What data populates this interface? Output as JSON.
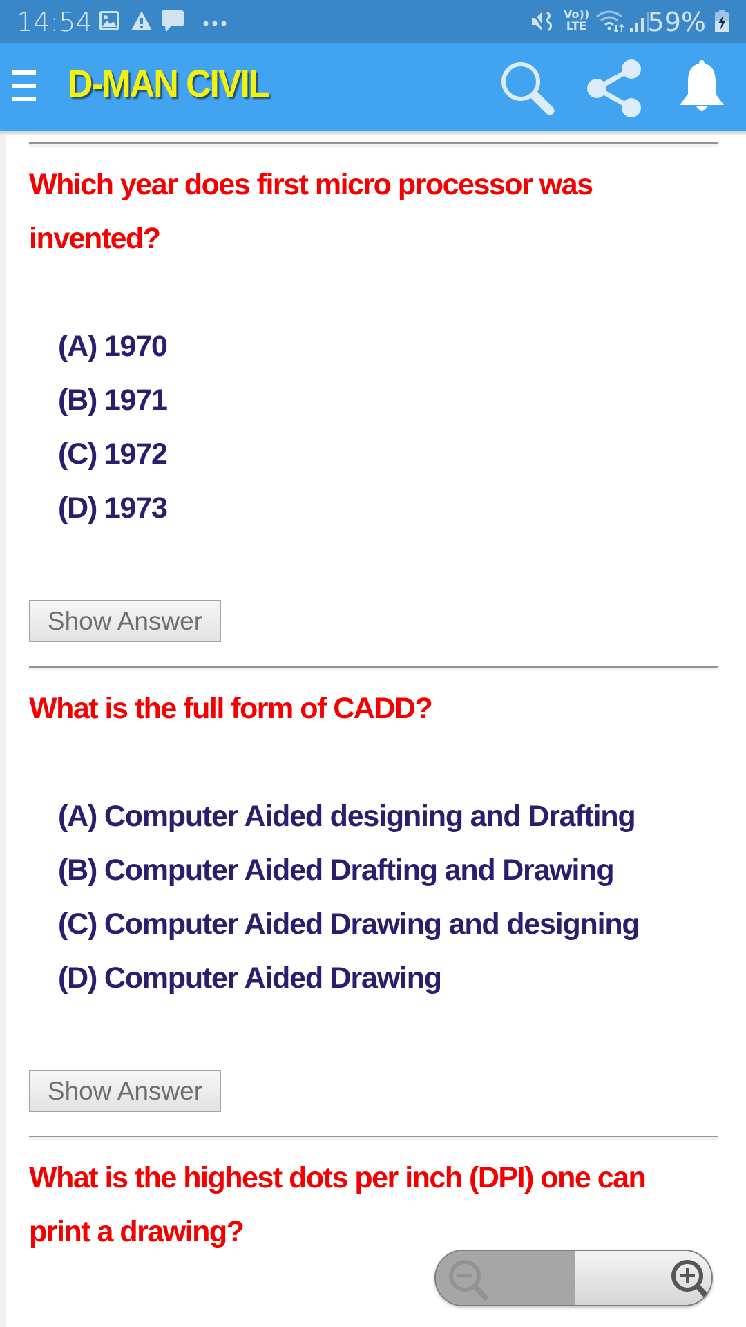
{
  "status_bar": {
    "time": "14:54",
    "left_icons": [
      "image-icon",
      "warning-icon",
      "message-icon",
      "more-dots-icon"
    ],
    "right_icons": [
      "mute-vibrate-icon",
      "volte-icon",
      "wifi-icon",
      "signal-icon"
    ],
    "volte_label_top": "Vo))",
    "volte_label_bottom": "LTE",
    "battery_percent": "59%",
    "battery_icon": "battery-charging-icon"
  },
  "app_bar": {
    "title": "D-MAN CIVIL",
    "menu_icon": "hamburger-menu-icon",
    "actions": [
      "search-icon",
      "share-icon",
      "bell-icon"
    ],
    "background_color": "#42a3f1",
    "title_color": "#f2f20e"
  },
  "questions": [
    {
      "text": "Which year does first micro processor was invented?",
      "options": [
        "(A) 1970",
        "(B) 1971",
        "(C) 1972",
        "(D) 1973"
      ],
      "button_label": "Show Answer"
    },
    {
      "text": "What is the full form of CADD?",
      "options": [
        "(A) Computer Aided designing and Drafting",
        "(B) Computer Aided Drafting and Drawing",
        "(C) Computer Aided Drawing and designing",
        "(D) Computer Aided Drawing"
      ],
      "button_label": "Show Answer"
    },
    {
      "text": "What is the highest dots per inch (DPI) one can print a drawing?",
      "options": [],
      "button_label": ""
    }
  ],
  "colors": {
    "question": "#f40000",
    "option": "#2c1e6e"
  },
  "zoom_control": {
    "zoom_out_icon": "zoom-out-icon",
    "zoom_in_icon": "zoom-in-icon"
  }
}
